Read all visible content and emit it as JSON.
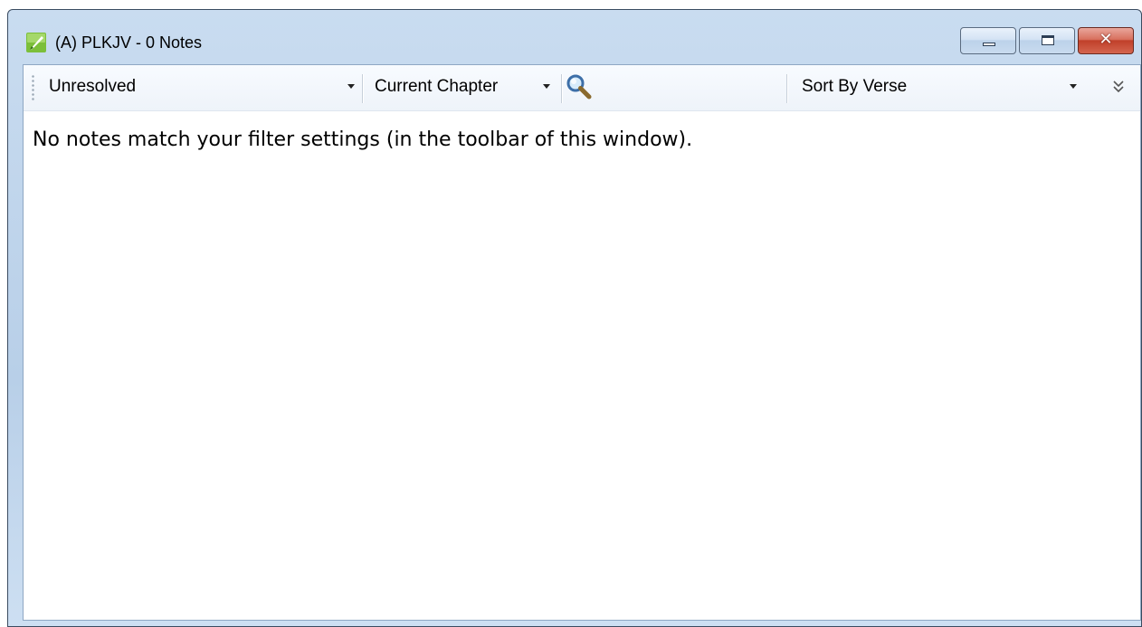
{
  "window": {
    "title": "(A) PLKJV - 0 Notes",
    "icon": "quill-icon",
    "close_glyph": "✕"
  },
  "toolbar": {
    "status_filter": "Unresolved",
    "scope_filter": "Current Chapter",
    "search_value": "",
    "sort_option": "Sort By Verse",
    "overflow_icon": "chevron-double-down-icon"
  },
  "content": {
    "empty_message": "No notes match your filter settings (in the toolbar of this window)."
  },
  "colors": {
    "title_bar": "#c9dcf0",
    "close_button": "#c0402a",
    "icon_green": "#7cbf3a"
  }
}
